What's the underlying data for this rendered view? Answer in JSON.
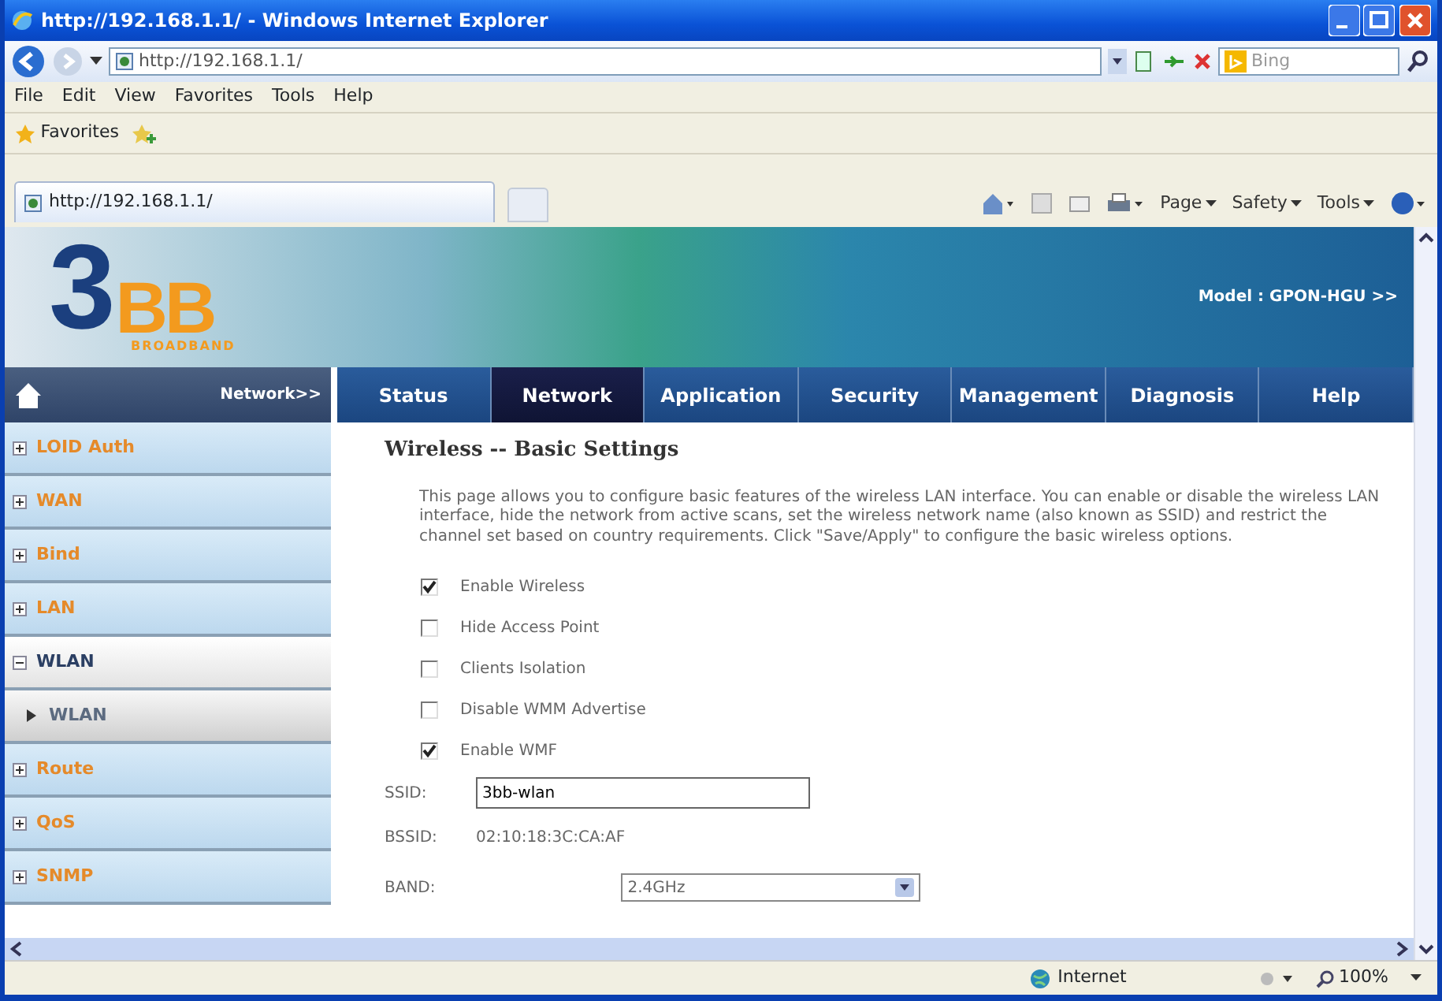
{
  "window": {
    "title": "http://192.168.1.1/ - Windows Internet Explorer"
  },
  "address_bar": {
    "url": "http://192.168.1.1/"
  },
  "search": {
    "placeholder": "Bing"
  },
  "menu": [
    "File",
    "Edit",
    "View",
    "Favorites",
    "Tools",
    "Help"
  ],
  "favorites_bar": {
    "label": "Favorites"
  },
  "browser_tab": {
    "title": "http://192.168.1.1/"
  },
  "command_bar": [
    "Page",
    "Safety",
    "Tools"
  ],
  "page": {
    "logo": {
      "numeral": "3",
      "letters": "BB",
      "tagline": "BROADBAND"
    },
    "model": "Model : GPON-HGU >>",
    "breadcrumb": "Network>>",
    "tabs": [
      {
        "label": "Status",
        "selected": false
      },
      {
        "label": "Network",
        "selected": true
      },
      {
        "label": "Application",
        "selected": false
      },
      {
        "label": "Security",
        "selected": false
      },
      {
        "label": "Management",
        "selected": false
      },
      {
        "label": "Diagnosis",
        "selected": false
      },
      {
        "label": "Help",
        "selected": false
      }
    ],
    "sidebar": {
      "items": [
        {
          "label": "LOID Auth",
          "expanded": false
        },
        {
          "label": "WAN",
          "expanded": false
        },
        {
          "label": "Bind",
          "expanded": false
        },
        {
          "label": "LAN",
          "expanded": false
        },
        {
          "label": "WLAN",
          "expanded": true,
          "children": [
            {
              "label": "WLAN",
              "selected": true
            }
          ]
        },
        {
          "label": "Route",
          "expanded": false
        },
        {
          "label": "QoS",
          "expanded": false
        },
        {
          "label": "SNMP",
          "expanded": false
        }
      ]
    },
    "heading": "Wireless -- Basic Settings",
    "description": "This page allows you to configure basic features of the wireless LAN interface. You can enable or disable the wireless LAN interface, hide the network from active scans, set the wireless network name (also known as SSID) and restrict the channel set based on country requirements. Click \"Save/Apply\" to configure the basic wireless options.",
    "options": [
      {
        "label": "Enable Wireless",
        "checked": true
      },
      {
        "label": "Hide Access Point",
        "checked": false
      },
      {
        "label": "Clients Isolation",
        "checked": false
      },
      {
        "label": "Disable WMM Advertise",
        "checked": false
      },
      {
        "label": "Enable WMF",
        "checked": true
      }
    ],
    "ssid": {
      "label": "SSID:",
      "value": "3bb-wlan"
    },
    "bssid": {
      "label": "BSSID:",
      "value": "02:10:18:3C:CA:AF"
    },
    "band": {
      "label": "BAND:",
      "value": "2.4GHz"
    }
  },
  "status_bar": {
    "zone": "Internet",
    "zoom": "100%"
  }
}
